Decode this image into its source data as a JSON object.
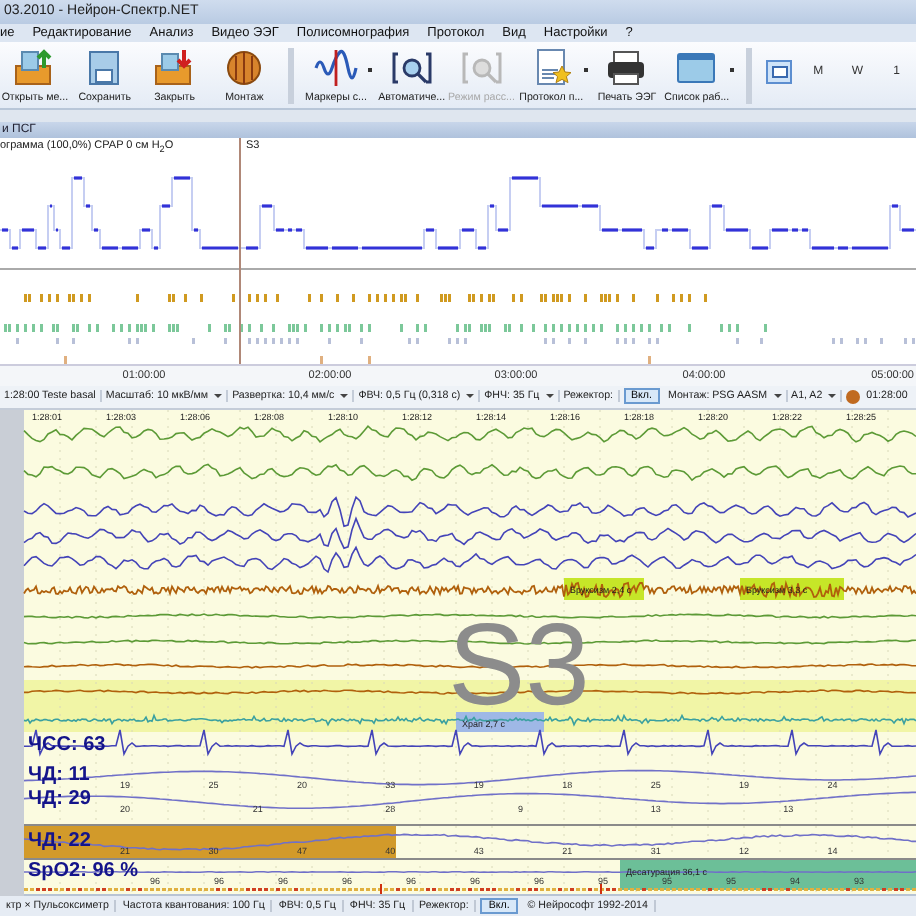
{
  "window": {
    "title": "03.2010 - Нейрон-Спектр.NET"
  },
  "menu": [
    "ие",
    "Редактирование",
    "Анализ",
    "Видео ЭЭГ",
    "Полисомнография",
    "Протокол",
    "Вид",
    "Настройки",
    "?"
  ],
  "ribbon": {
    "buttons": [
      {
        "label": "Открыть ме...",
        "disabled": false,
        "dropdown": false
      },
      {
        "label": "Сохранить",
        "disabled": false,
        "dropdown": false
      },
      {
        "label": "Закрыть",
        "disabled": false,
        "dropdown": false
      },
      {
        "label": "Монтаж",
        "disabled": false,
        "dropdown": false
      },
      {
        "label": "Маркеры с...",
        "disabled": false,
        "dropdown": true
      },
      {
        "label": "Автоматиче...",
        "disabled": false,
        "dropdown": false
      },
      {
        "label": "Режим расс...",
        "disabled": true,
        "dropdown": false
      },
      {
        "label": "Протокол п...",
        "disabled": false,
        "dropdown": true
      },
      {
        "label": "Печать ЭЭГ",
        "disabled": false,
        "dropdown": false
      },
      {
        "label": "Список раб...",
        "disabled": false,
        "dropdown": true
      }
    ],
    "view_buttons": [
      {
        "selected": true
      },
      {
        "label": "M",
        "selected": false
      },
      {
        "label": "W",
        "selected": false
      },
      {
        "label": "1",
        "selected": false
      }
    ]
  },
  "overview": {
    "panel_title": "и ПСГ",
    "hypnogram_caption": "ограмма (100,0%) CPAP 0 см H$_{2}$O",
    "stage_marker": "S3",
    "time_ticks": [
      "01:00:00",
      "02:00:00",
      "03:00:00",
      "04:00:00",
      "05:00:00"
    ]
  },
  "signal_toolbar": [
    {
      "kind": "text",
      "text": "1:28:00 Teste basal"
    },
    {
      "kind": "combo",
      "text": "Масштаб: 10 мкВ/мм"
    },
    {
      "kind": "combo",
      "text": "Развертка: 10,4 мм/с"
    },
    {
      "kind": "combo",
      "text": "ФВЧ: 0,5 Гц (0,318 с)"
    },
    {
      "kind": "combo",
      "text": "ФНЧ: 35 Гц"
    },
    {
      "kind": "text",
      "text": "Режектор:"
    },
    {
      "kind": "toggle",
      "text": "Вкл.",
      "on": true
    },
    {
      "kind": "combo",
      "text": "Монтаж: PSG AASM"
    },
    {
      "kind": "combo",
      "text": "A1, A2"
    },
    {
      "kind": "clock",
      "text": "01:28:00"
    }
  ],
  "signals": {
    "time_labels": [
      "1:28:01",
      "1:28:03",
      "1:28:06",
      "1:28:08",
      "1:28:10",
      "1:28:12",
      "1:28:14",
      "1:28:16",
      "1:28:18",
      "1:28:20",
      "1:28:22",
      "1:28:25"
    ],
    "stage": "S3",
    "channels": [
      {
        "kind": "eeg",
        "color": "#5c9a36"
      },
      {
        "kind": "eeg",
        "color": "#5c9a36"
      },
      {
        "kind": "eeg",
        "color": "#4444b8"
      },
      {
        "kind": "eeg",
        "color": "#4444b8"
      },
      {
        "kind": "eeg",
        "color": "#4444b8"
      },
      {
        "kind": "emg",
        "color": "#b0600c",
        "annotations": [
          {
            "text": "Бруксизм 2,4 с",
            "kind": "event"
          },
          {
            "text": "Бруксизм 3,3 с",
            "kind": "event"
          }
        ]
      },
      {
        "kind": "flat",
        "color": "#5c9a36"
      },
      {
        "kind": "flat",
        "color": "#5c9a36"
      },
      {
        "kind": "flat",
        "color": "#b0600c"
      },
      {
        "kind": "flat",
        "color": "#b0600c"
      },
      {
        "kind": "sound",
        "color": "#3aa0a0",
        "annotations": [
          {
            "text": "Храп 2,7 с",
            "kind": "snore"
          }
        ]
      },
      {
        "kind": "ecg",
        "color": "#4444b8",
        "label": "ЧСС: 63"
      },
      {
        "kind": "resp",
        "color": "#7070c8",
        "label": "ЧД: 11",
        "values": [
          "19",
          "25",
          "20",
          "33",
          "19",
          "18",
          "25",
          "19",
          "24"
        ]
      },
      {
        "kind": "resp",
        "color": "#7070c8",
        "label": "ЧД: 29",
        "values": [
          "20",
          "21",
          "28",
          "9",
          "13",
          "13"
        ]
      },
      {
        "kind": "resp",
        "color": "#7070c8",
        "label": "ЧД: 22",
        "values": [
          "21",
          "30",
          "47",
          "40",
          "43",
          "21",
          "31",
          "12",
          "14"
        ]
      },
      {
        "kind": "spo2",
        "color": "#7070c8",
        "label": "SpO2: 96 %",
        "values": [
          "96",
          "96",
          "96",
          "96",
          "96",
          "96",
          "96",
          "95",
          "95",
          "95",
          "94",
          "93"
        ],
        "annotations": [
          {
            "text": "Десатурация 36,1 с",
            "kind": "desaturation"
          }
        ]
      }
    ]
  },
  "status_bar": [
    {
      "kind": "text",
      "text": "ктр × Пульсоксиметр"
    },
    {
      "kind": "text",
      "text": "Частота квантования: 100 Гц"
    },
    {
      "kind": "text",
      "text": "ФВЧ: 0,5 Гц"
    },
    {
      "kind": "text",
      "text": "ФНЧ: 35 Гц"
    },
    {
      "kind": "text",
      "text": "Режектор:"
    },
    {
      "kind": "toggle",
      "text": "Вкл.",
      "on": true
    },
    {
      "kind": "text",
      "text": "© Нейрософт 1992-2014"
    }
  ]
}
